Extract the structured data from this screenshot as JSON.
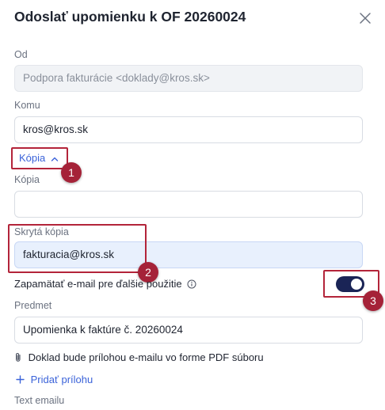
{
  "dialog": {
    "title": "Odoslať upomienku k OF 20260024"
  },
  "from": {
    "label": "Od",
    "value": "Podpora fakturácie <doklady@kros.sk>"
  },
  "to": {
    "label": "Komu",
    "value": "kros@kros.sk"
  },
  "copy_toggle": {
    "label": "Kópia"
  },
  "cc": {
    "label": "Kópia",
    "value": ""
  },
  "bcc": {
    "label": "Skrytá kópia",
    "value": "fakturacia@kros.sk"
  },
  "remember": {
    "label": "Zapamätať e-mail pre ďalšie použitie",
    "enabled": true
  },
  "subject": {
    "label": "Predmet",
    "value": "Upomienka k faktúre č. 20260024"
  },
  "attachment": {
    "note": "Doklad bude prílohou e-mailu vo forme PDF súboru",
    "add_label": "Pridať prílohu"
  },
  "body": {
    "label": "Text emailu"
  },
  "annotations": [
    "1",
    "2",
    "3"
  ],
  "colors": {
    "accent": "#3b63d9",
    "annotation": "#a52238",
    "toggle_on": "#1a2456",
    "highlight_field": "#e8f0fd"
  }
}
